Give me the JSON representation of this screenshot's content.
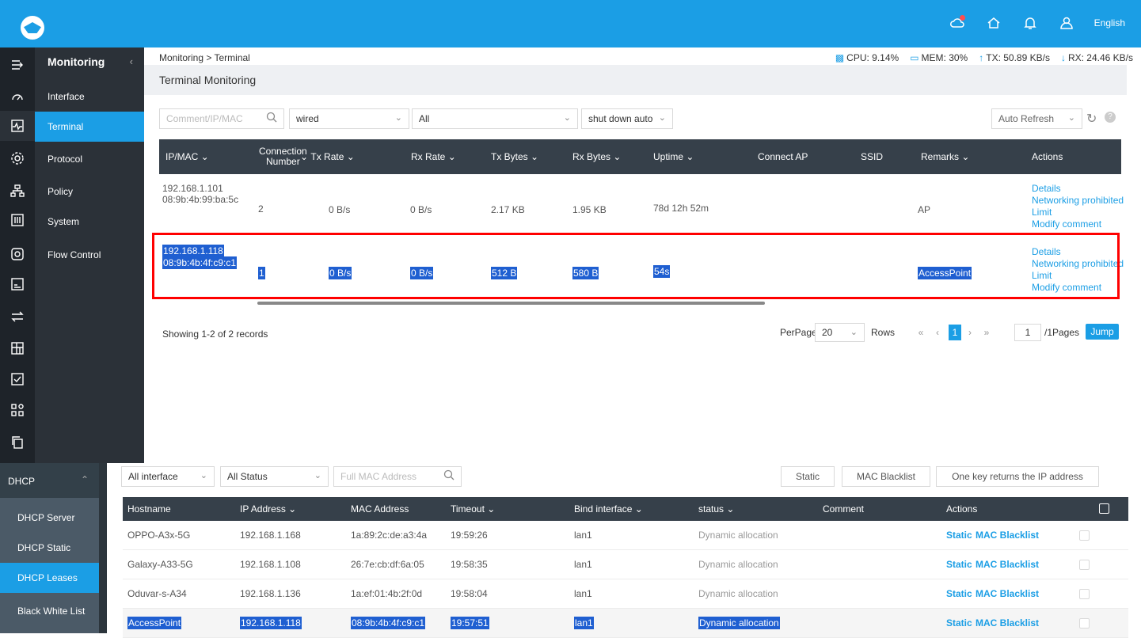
{
  "header": {
    "language": "English"
  },
  "sidebar": {
    "title": "Monitoring",
    "items": [
      {
        "label": "Interface"
      },
      {
        "label": "Terminal"
      },
      {
        "label": "Protocol"
      },
      {
        "label": "Policy"
      },
      {
        "label": "System"
      },
      {
        "label": "Flow Control"
      }
    ]
  },
  "breadcrumb": "Monitoring > Terminal",
  "stats": {
    "cpu": "CPU: 9.14%",
    "mem": "MEM: 30%",
    "tx": "TX: 50.89 KB/s",
    "rx": "RX: 24.46 KB/s"
  },
  "page_title": "Terminal Monitoring",
  "filters": {
    "search_placeholder": "Comment/IP/MAC",
    "type": "wired",
    "scope": "All",
    "shutdown": "shut down auto",
    "refresh": "Auto Refresh"
  },
  "terminal_table": {
    "columns": [
      "IP/MAC",
      "Connection Number",
      "Tx Rate",
      "Rx Rate",
      "Tx Bytes",
      "Rx Bytes",
      "Uptime",
      "Connect AP",
      "SSID",
      "Remarks",
      "Actions"
    ],
    "rows": [
      {
        "ip": "192.168.1.101",
        "mac": "08:9b:4b:99:ba:5c",
        "conn": "2",
        "tx_rate": "0 B/s",
        "rx_rate": "0 B/s",
        "tx_bytes": "2.17 KB",
        "rx_bytes": "1.95 KB",
        "uptime": "78d 12h 52m",
        "remarks": "AP"
      },
      {
        "ip": "192.168.1.118",
        "mac": "08:9b:4b:4f:c9:c1",
        "conn": "1",
        "tx_rate": "0 B/s",
        "rx_rate": "0 B/s",
        "tx_bytes": "512 B",
        "rx_bytes": "580 B",
        "uptime": "54s",
        "remarks": "AccessPoint"
      }
    ],
    "actions": [
      "Details",
      "Networking prohibited",
      "Limit",
      "Modify comment"
    ]
  },
  "pagination": {
    "summary": "Showing 1-2 of 2 records",
    "perpage_label": "PerPage",
    "perpage": "20",
    "rows_label": "Rows",
    "current": "1",
    "goto": "1",
    "pages": "/1Pages",
    "jump": "Jump"
  },
  "dhcp_nav": {
    "title": "DHCP",
    "items": [
      {
        "label": "DHCP Server"
      },
      {
        "label": "DHCP Static"
      },
      {
        "label": "DHCP Leases"
      },
      {
        "label": "Black White List"
      }
    ]
  },
  "dhcp_filters": {
    "interface": "All interface",
    "status": "All Status",
    "mac_placeholder": "Full MAC Address",
    "static_btn": "Static",
    "blacklist_btn": "MAC Blacklist",
    "return_btn": "One key returns the IP address"
  },
  "leases_table": {
    "columns": [
      "Hostname",
      "IP Address",
      "MAC Address",
      "Timeout",
      "Bind interface",
      "status",
      "Comment",
      "Actions"
    ],
    "rows": [
      {
        "host": "OPPO-A3x-5G",
        "ip": "192.168.1.168",
        "mac": "1a:89:2c:de:a3:4a",
        "timeout": "19:59:26",
        "iface": "lan1",
        "status": "Dynamic allocation"
      },
      {
        "host": "Galaxy-A33-5G",
        "ip": "192.168.1.108",
        "mac": "26:7e:cb:df:6a:05",
        "timeout": "19:58:35",
        "iface": "lan1",
        "status": "Dynamic allocation"
      },
      {
        "host": "Oduvar-s-A34",
        "ip": "192.168.1.136",
        "mac": "1a:ef:01:4b:2f:0d",
        "timeout": "19:58:04",
        "iface": "lan1",
        "status": "Dynamic allocation"
      },
      {
        "host": "AccessPoint",
        "ip": "192.168.1.118",
        "mac": "08:9b:4b:4f:c9:c1",
        "timeout": "19:57:51",
        "iface": "lan1",
        "status": "Dynamic allocation"
      }
    ],
    "action_static": "Static",
    "action_blacklist": "MAC Blacklist"
  },
  "colors": {
    "brand": "#1b9ee5",
    "highlight": "#1f5fd1",
    "box": "#ff0000"
  }
}
